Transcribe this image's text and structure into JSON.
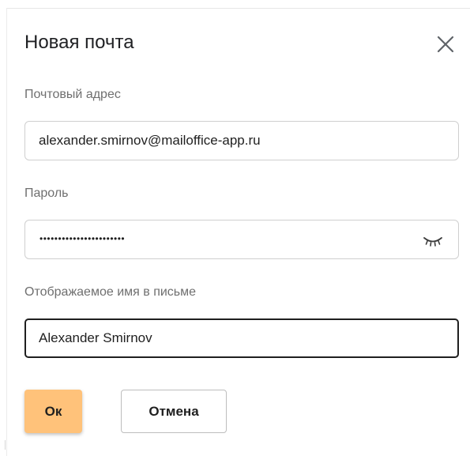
{
  "dialog": {
    "title": "Новая почта",
    "close_icon": "close-icon"
  },
  "email": {
    "label": "Почтовый адрес",
    "value": "alexander.smirnov@mailoffice-app.ru"
  },
  "password": {
    "label": "Пароль",
    "masked_value": "•••••••••••••••••••••••",
    "toggle_icon": "eye-closed-icon"
  },
  "display_name": {
    "label": "Отображаемое имя в письме",
    "value": "Alexander Smirnov"
  },
  "actions": {
    "ok_label": "Ок",
    "cancel_label": "Отмена"
  },
  "colors": {
    "accent": "#ffc27a",
    "focus_border": "#1f1f1f"
  }
}
